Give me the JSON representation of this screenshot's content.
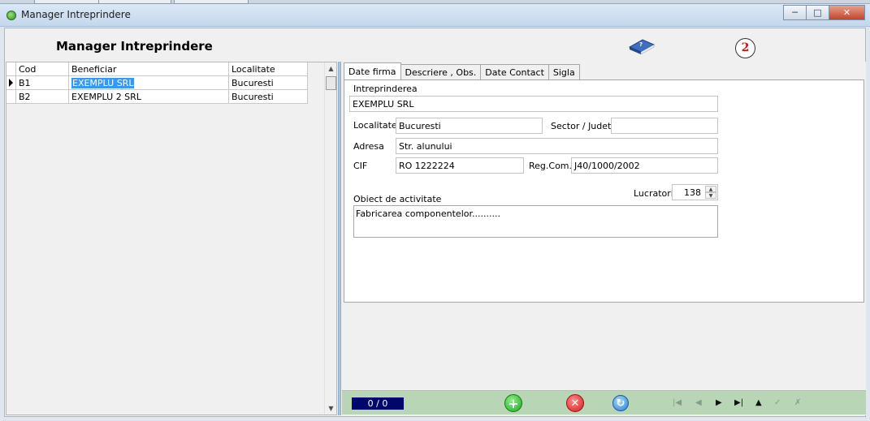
{
  "window": {
    "title": "Manager Intreprindere",
    "header_title": "Manager Intreprindere",
    "badge": "2"
  },
  "grid": {
    "columns": [
      "Cod",
      "Beneficiar",
      "Localitate"
    ],
    "rows": [
      {
        "cod": "B1",
        "beneficiar": "EXEMPLU SRL",
        "localitate": "Bucuresti"
      },
      {
        "cod": "B2",
        "beneficiar": "EXEMPLU 2 SRL",
        "localitate": "Bucuresti"
      }
    ]
  },
  "tabs": [
    "Date firma",
    "Descriere , Obs.",
    "Date Contact",
    "Sigla"
  ],
  "form": {
    "intreprinderea_label": "Intreprinderea",
    "intreprinderea": "EXEMPLU SRL",
    "localitate_label": "Localitate",
    "localitate": "Bucuresti",
    "sector_label": "Sector / Judet",
    "sector": "",
    "adresa_label": "Adresa",
    "adresa": "Str. alunului",
    "cif_label": "CIF",
    "cif": "RO 1222224",
    "regcom_label": "Reg.Com.",
    "regcom": "J40/1000/2002",
    "lucratori_label": "Lucratori",
    "lucratori": "138",
    "obiect_label": "Obiect de activitate",
    "obiect": "Fabricarea componentelor.........."
  },
  "toolbar": {
    "counter": "0 / 0"
  },
  "icons": {
    "app": "app-icon",
    "help_book": "book-icon",
    "add": "add-icon",
    "delete": "delete-icon",
    "refresh": "refresh-icon"
  },
  "colors": {
    "selection": "#3399ff",
    "toolbar_bg": "#b8d5b6",
    "counter_bg": "#00066c",
    "badge_text": "#c41a1a"
  }
}
